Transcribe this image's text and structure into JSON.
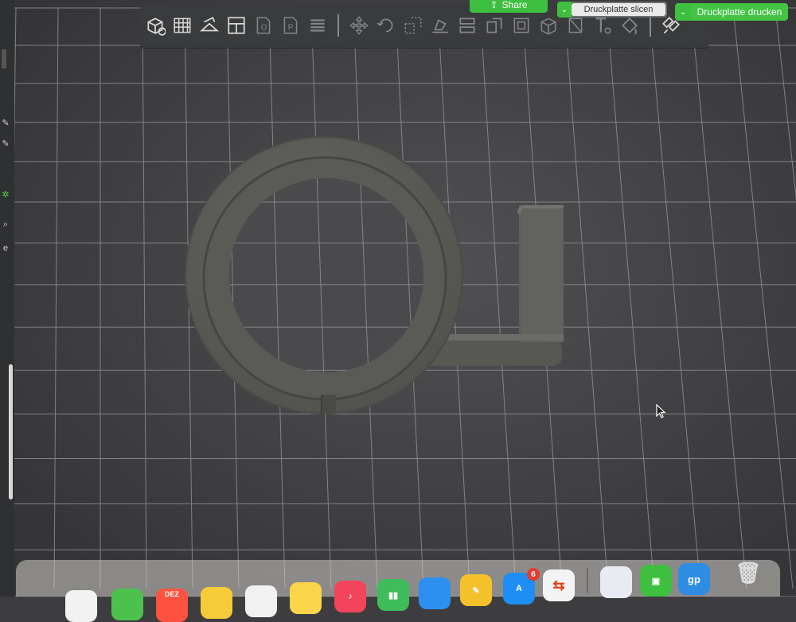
{
  "header": {
    "share_label": "Share",
    "slice_label": "Druckplatte slicen",
    "print_label": "Druckplatte drucken"
  },
  "toolbar": {
    "icons": [
      "add-cube-icon",
      "grid-plate-icon",
      "auto-orient-icon",
      "arrange-layout-icon",
      "object-view-icon",
      "plate-view-icon",
      "layers-icon",
      "move-icon",
      "rotate-icon",
      "scale-icon",
      "lay-on-face-icon",
      "cut-icon",
      "split-icon",
      "split-parts-icon",
      "support-paint-icon",
      "seam-paint-icon",
      "text-icon",
      "color-paint-icon",
      "assembly-icon"
    ]
  },
  "dock": {
    "calendar_month": "DEZ",
    "appstore_badge": "6",
    "guitarpro_label": "gp"
  },
  "colors": {
    "accent_green": "#3fbf3f",
    "plate": "#47474a",
    "model": "#5b5c58"
  }
}
